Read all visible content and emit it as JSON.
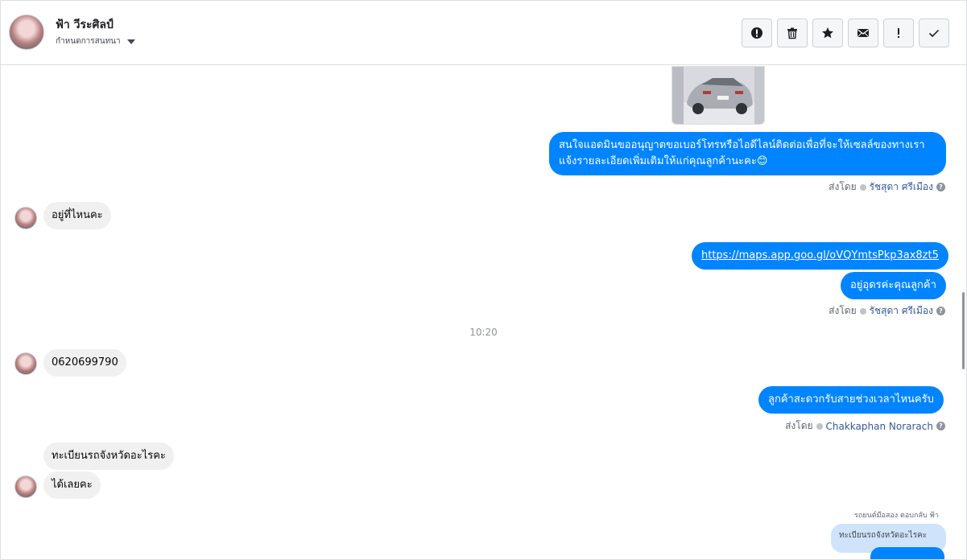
{
  "header": {
    "contact_name": "ฟ้า วีระศิลป์",
    "assign_label": "กำหนดการสนทนา",
    "actions": [
      {
        "name": "spam-button",
        "icon": "alert-circle-icon"
      },
      {
        "name": "delete-button",
        "icon": "trash-icon"
      },
      {
        "name": "star-button",
        "icon": "star-icon"
      },
      {
        "name": "mark-unread-button",
        "icon": "envelope-icon"
      },
      {
        "name": "follow-up-button",
        "icon": "exclamation-icon"
      },
      {
        "name": "mark-done-button",
        "icon": "check-icon"
      }
    ]
  },
  "messages": {
    "out1": "สนใจแอดมินขออนุญาตขอเบอร์โทรหรือไอดีไลน์ติดต่อเพื่อที่จะให้เซลล์ของทางเรา\nแจ้งรายละเอียดเพิ่มเติมให้แก่คุณลูกค้านะคะ😊",
    "sent1_prefix": "ส่งโดย",
    "sent1_agent": "รัชสุดา ศรีเมือง",
    "in1": "อยู่ที่ไหนคะ",
    "out2_link": "https://maps.app.goo.gl/oVQYmtsPkp3ax8zt5",
    "out3": "อยู่อุดรค่ะคุณลูกค้า",
    "sent2_prefix": "ส่งโดย",
    "sent2_agent": "รัชสุดา ศรีเมือง",
    "time1": "10:20",
    "in2": "0620699790",
    "out4": "ลูกค้าสะดวกรับสายช่วงเวลาไหนครับ",
    "sent3_prefix": "ส่งโดย",
    "sent3_agent": "Chakkaphan Norarach",
    "in3": "ทะเบียนรถจังหวัดอะไรคะ",
    "in4": "ได้เลยคะ",
    "reply_label": "รถยนต์มือสอง ตอบกลับ ฟ้า",
    "reply_quote": "ทะเบียนรถจังหวัดอะไรคะ"
  },
  "colors": {
    "outgoing": "#0084ff",
    "incoming": "#f1f0f0",
    "agent_link": "#385898"
  }
}
